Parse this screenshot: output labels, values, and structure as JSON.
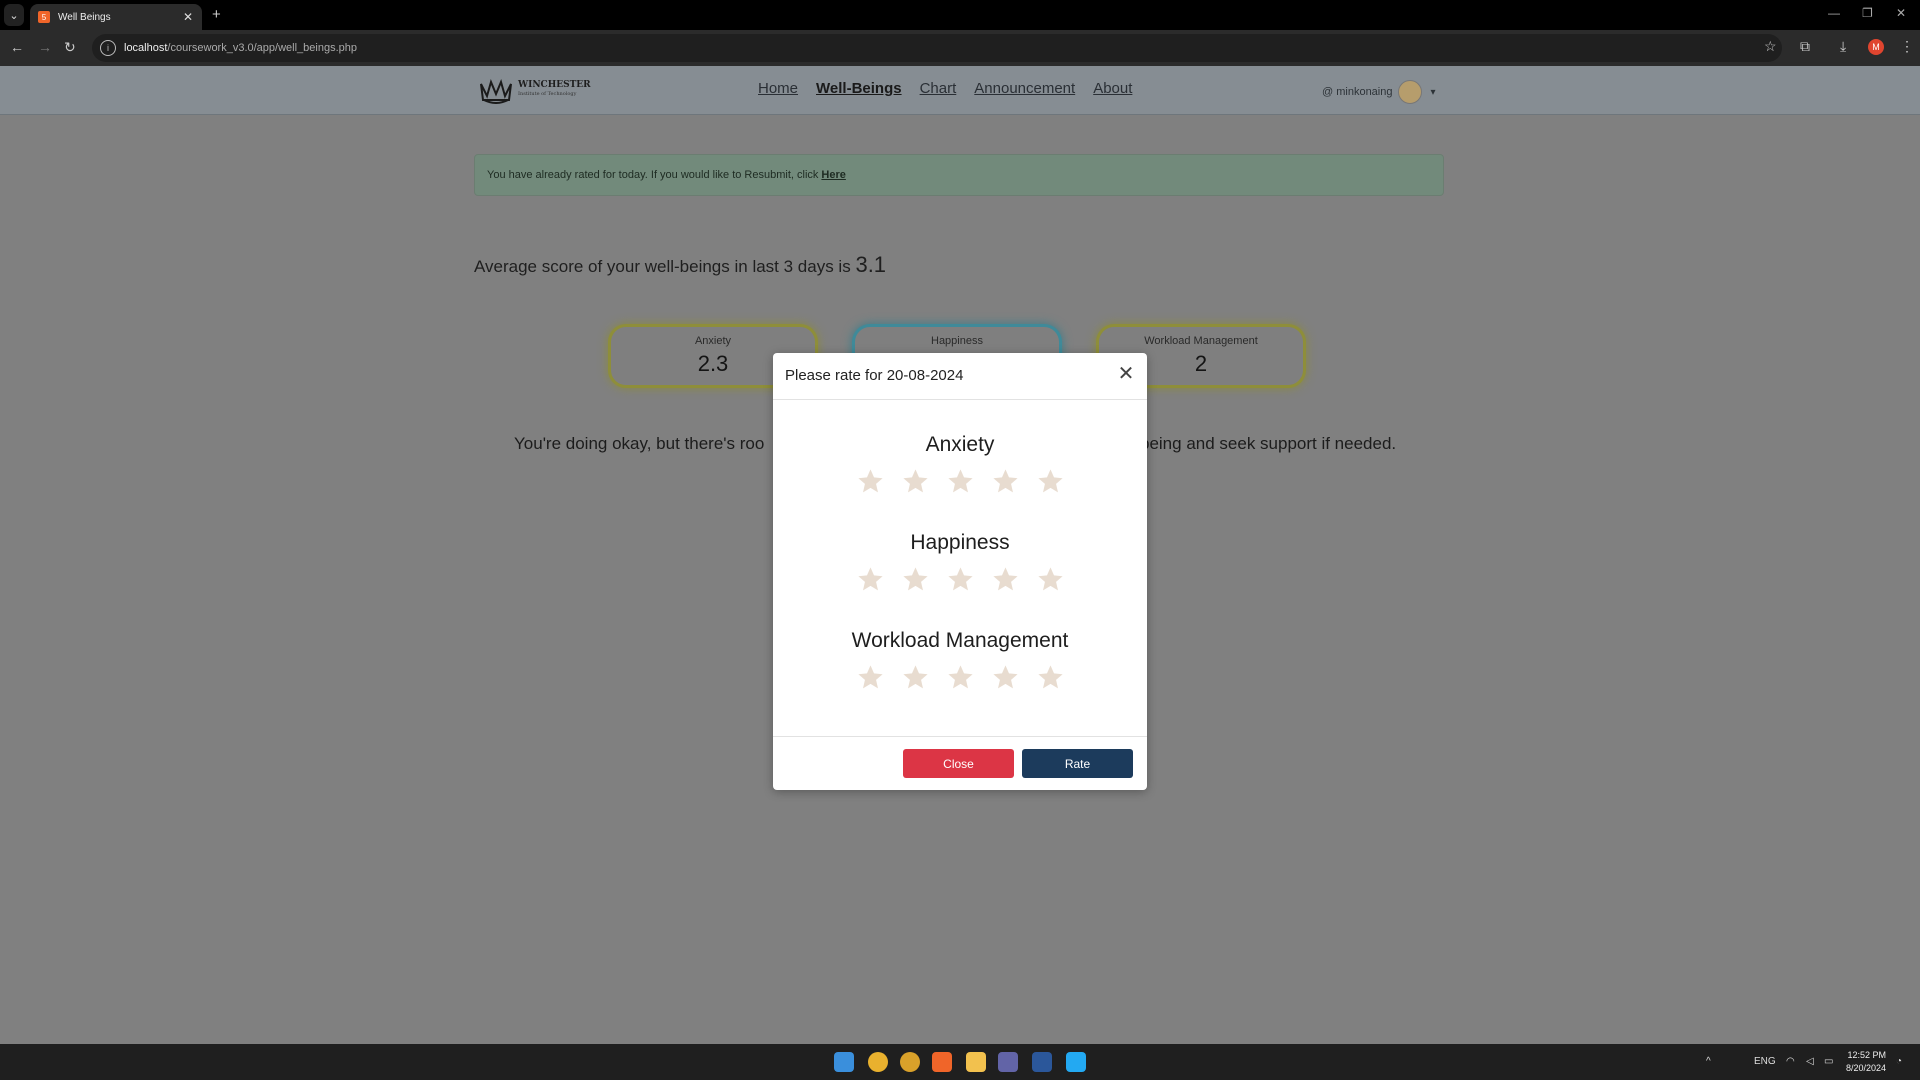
{
  "browser": {
    "tab_title": "Well Beings",
    "url_host": "localhost",
    "url_path": "/coursework_v3.0/app/well_beings.php",
    "profile_initial": "M"
  },
  "site": {
    "logo_name": "WINCHESTER",
    "logo_sub": "Institute of Technology",
    "nav": [
      "Home",
      "Well-Beings",
      "Chart",
      "Announcement",
      "About"
    ],
    "user": "@ minkonaing"
  },
  "alert": {
    "text": "You have already rated for today. If you would like to Resubmit, click",
    "link": "Here"
  },
  "summary": {
    "text": "Average score of your well-beings in last 3 days is",
    "score": "3.1"
  },
  "cards": [
    {
      "label": "Anxiety",
      "value": "2.3"
    },
    {
      "label": "Happiness",
      "value": ""
    },
    {
      "label": "Workload Management",
      "value": "2"
    }
  ],
  "message": {
    "left": "You're doing okay, but there's roo",
    "right": "being and seek support if needed."
  },
  "modal": {
    "title": "Please rate for 20-08-2024",
    "groups": [
      {
        "title": "Anxiety",
        "rating": 0,
        "max": 5
      },
      {
        "title": "Happiness",
        "rating": 0,
        "max": 5
      },
      {
        "title": "Workload Management",
        "rating": 0,
        "max": 5
      }
    ],
    "close_label": "Close",
    "rate_label": "Rate"
  },
  "taskbar": {
    "lang": "ENG",
    "time": "12:52 PM",
    "date": "8/20/2024"
  },
  "colors": {
    "star_empty": "#e8dcd0",
    "close_button": "#dc3545",
    "rate_button": "#1c3b5c"
  }
}
